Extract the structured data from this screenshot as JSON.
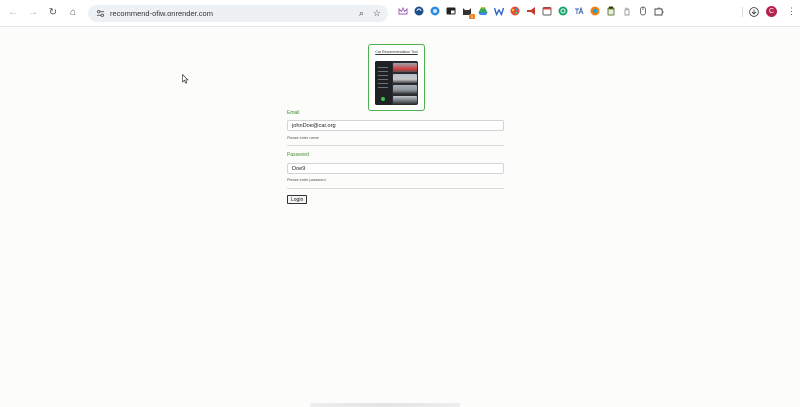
{
  "browser": {
    "url": "recommend-ofiw.onrender.com",
    "profile_initial": "C",
    "extension_badge": "1",
    "nav": {
      "back": "←",
      "forward": "→",
      "reload": "↻",
      "home": "⌂"
    },
    "omnibox_actions": {
      "zoom": "⌕",
      "bookmark": "☆"
    },
    "menu": "⋮"
  },
  "hero": {
    "title": "Car Recommendation Tool"
  },
  "form": {
    "email_label": "Email",
    "email_value": "johnDoe@car.org",
    "email_helper": "Please enter name",
    "password_label": "Password",
    "password_value": "Doe9",
    "password_helper": "Please enter password",
    "login_label": "Login"
  },
  "colors": {
    "accent_green": "#3c8f2c",
    "card_border": "#4caf50",
    "profile": "#b5234f",
    "page_bg": "#fcfcfa"
  }
}
